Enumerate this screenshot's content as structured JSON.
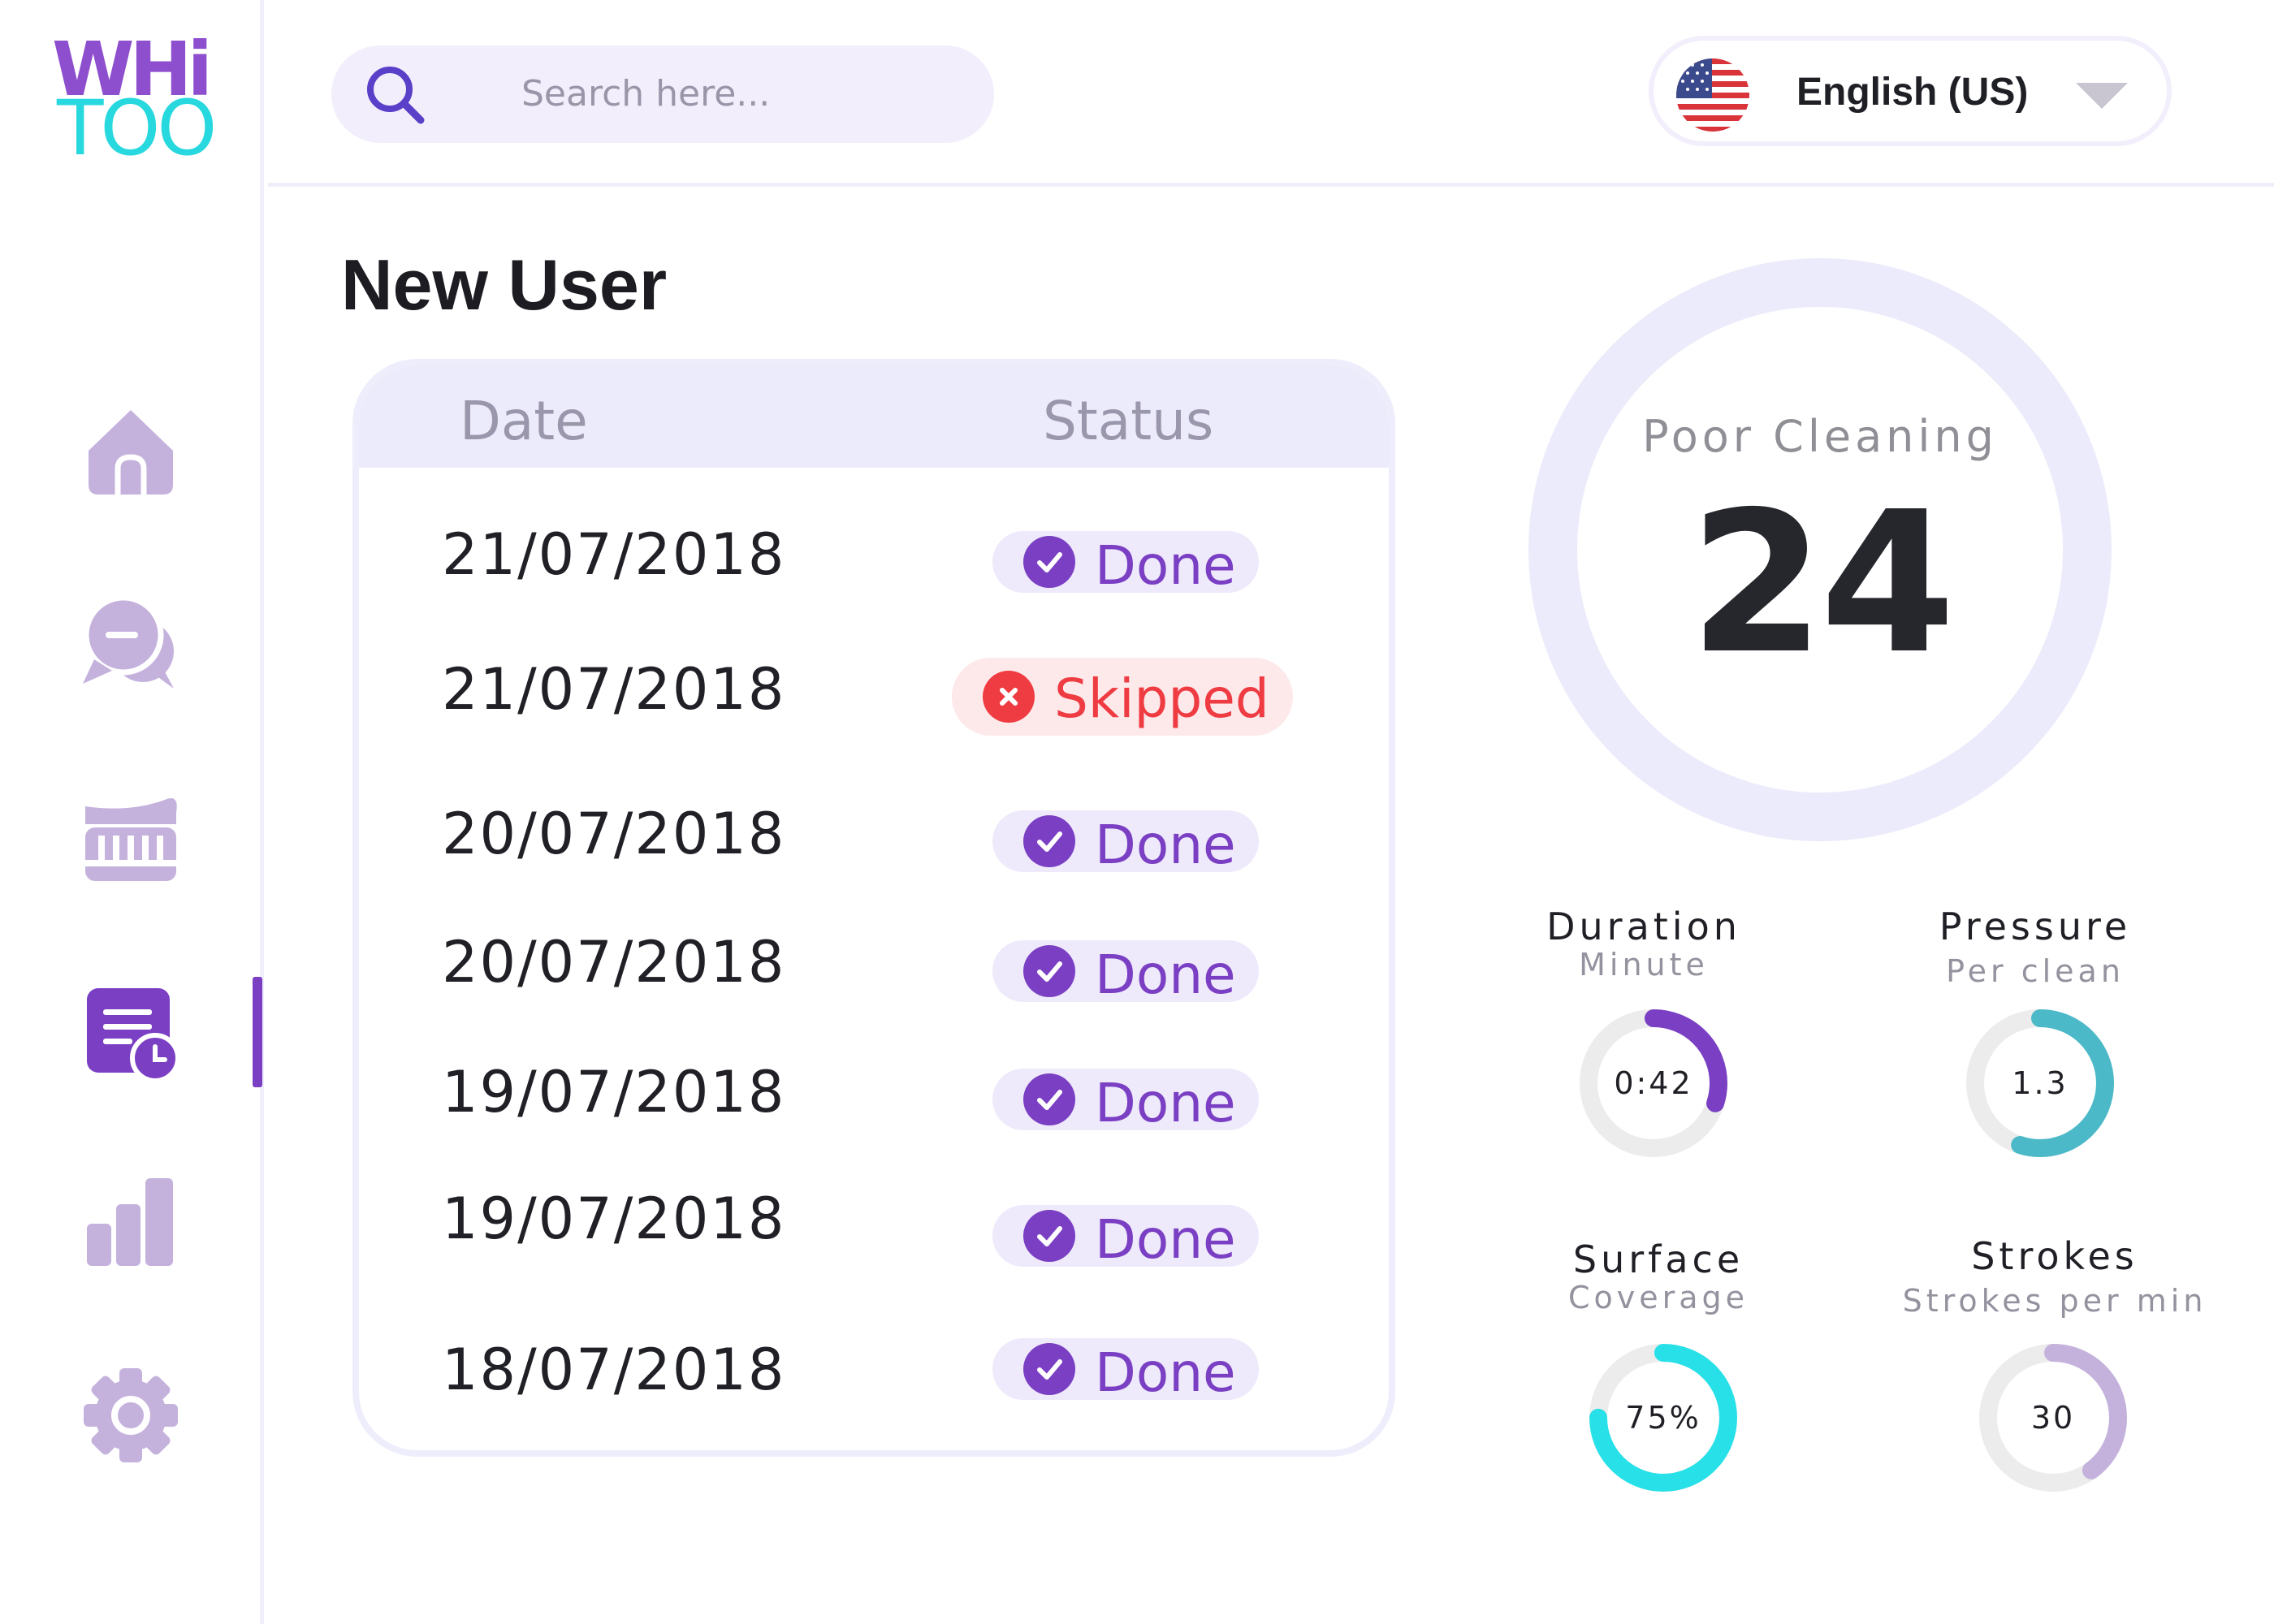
{
  "brand": {
    "line1": "WHi",
    "line2": "TOO"
  },
  "sidebar": {
    "items": [
      {
        "name": "home",
        "active": false
      },
      {
        "name": "messages",
        "active": false
      },
      {
        "name": "toothbrush",
        "active": false
      },
      {
        "name": "history",
        "active": true
      },
      {
        "name": "stats",
        "active": false
      },
      {
        "name": "settings",
        "active": false
      }
    ]
  },
  "search": {
    "placeholder": "Search here..."
  },
  "language": {
    "label": "English (US)"
  },
  "page": {
    "title": "New User"
  },
  "table": {
    "headers": {
      "date": "Date",
      "status": "Status"
    },
    "rows": [
      {
        "date": "21/07/2018",
        "status": "Done"
      },
      {
        "date": "21/07/2018",
        "status": "Skipped"
      },
      {
        "date": "20/07/2018",
        "status": "Done"
      },
      {
        "date": "20/07/2018",
        "status": "Done"
      },
      {
        "date": "19/07/2018",
        "status": "Done"
      },
      {
        "date": "19/07/2018",
        "status": "Done"
      },
      {
        "date": "18/07/2018",
        "status": "Done"
      }
    ]
  },
  "score": {
    "label": "Poor Cleaning",
    "value": "24"
  },
  "metrics": {
    "duration": {
      "title": "Duration",
      "subtitle": "Minute",
      "value": "0:42",
      "fraction": 0.3,
      "color": "#7a3fc3"
    },
    "pressure": {
      "title": "Pressure",
      "subtitle": "Per clean",
      "value": "1.3",
      "fraction": 0.55,
      "color": "#4bb9c8"
    },
    "surface": {
      "title": "Surface",
      "subtitle": "Coverage",
      "value": "75%",
      "fraction": 0.75,
      "color": "#27e0e8"
    },
    "strokes": {
      "title": "Strokes",
      "subtitle": "Strokes per min",
      "value": "30",
      "fraction": 0.4,
      "color": "#c4b2dd"
    }
  },
  "colors": {
    "accent": "#7a3fc3",
    "skipped": "#ef3b42",
    "icon": "#c4b2dd",
    "track": "#ececec"
  }
}
